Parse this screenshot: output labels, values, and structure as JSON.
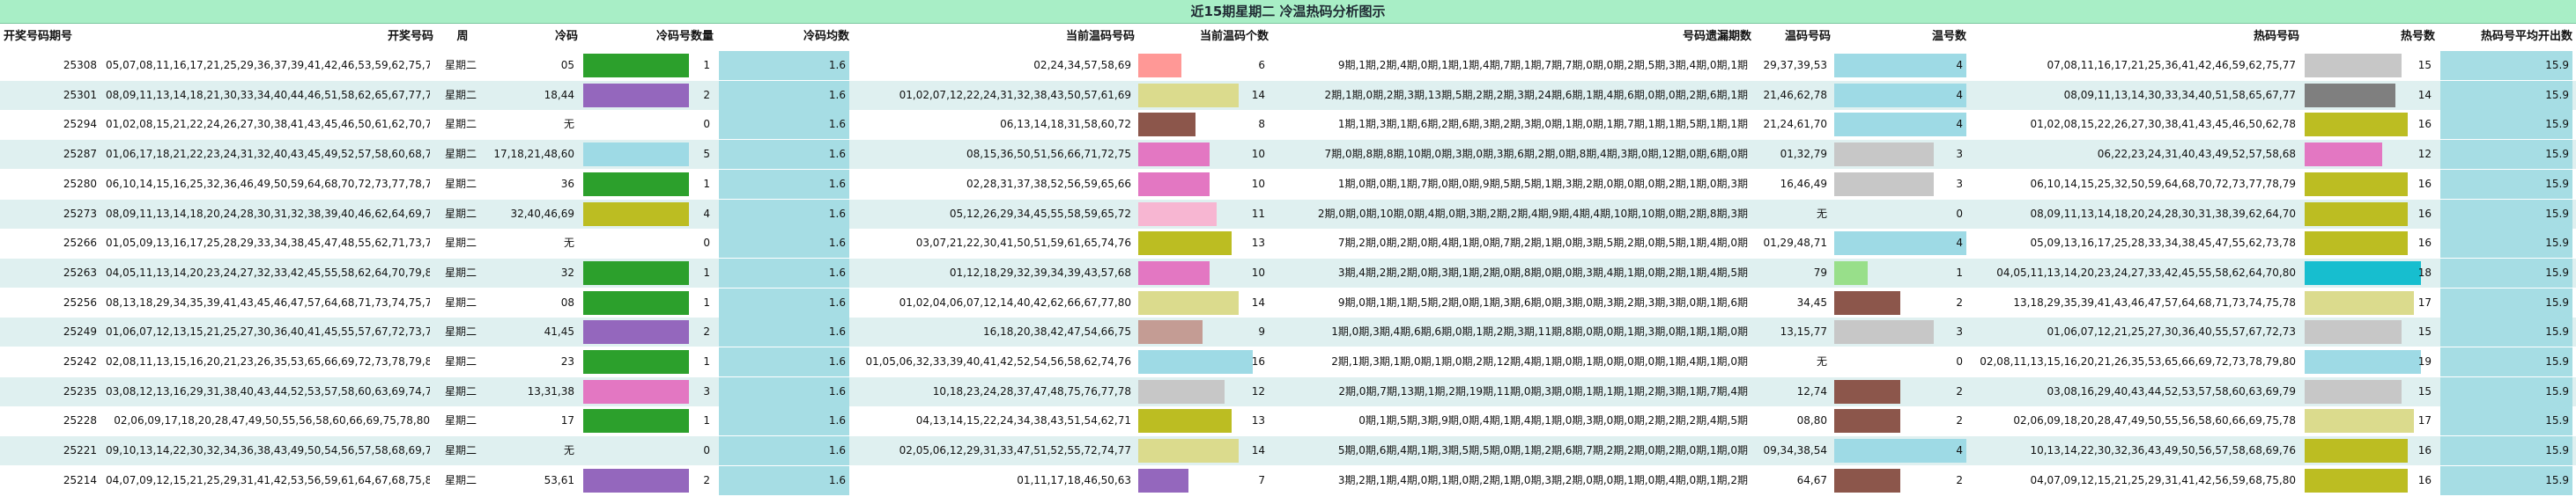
{
  "title": "近15期星期二 冷温热码分析图示",
  "headers": [
    "开奖号码期号",
    "开奖号码",
    "周",
    "冷码",
    "冷码号数量",
    "冷码均数",
    "当前温码号码",
    "当前温码个数",
    "号码遗漏期数",
    "温码号码",
    "温号数",
    "热码号码",
    "热号数",
    "热码号平均开出数"
  ],
  "rows": [
    {
      "issue": "25308",
      "numbers": "05,07,08,11,16,17,21,25,29,36,37,39,41,42,46,53,59,62,75,77",
      "week": "星期二",
      "cold": "05",
      "cold_count": "1",
      "cold_avg": "1.6",
      "warm_cur": "02,24,34,57,58,69",
      "warm_cur_count": "6",
      "miss": "9期,1期,2期,4期,0期,1期,1期,4期,7期,1期,7期,7期,0期,0期,2期,5期,3期,4期,0期,1期",
      "warm": "29,37,39,53",
      "warm_count": "4",
      "hot": "07,08,11,16,17,21,25,36,41,42,46,59,62,75,77",
      "hot_count": "15",
      "hot_avg": "15.9",
      "cold_color": "#2ca02c",
      "cold_frac": 1,
      "warm_cur_color": "#ff9896",
      "warm_cur_frac": 0.375,
      "warm_color": "#9edae5",
      "warm_frac": 1,
      "hot_color": "#c7c7c7",
      "hot_frac": 0.83
    },
    {
      "issue": "25301",
      "numbers": "08,09,11,13,14,18,21,30,33,34,40,44,46,51,58,62,65,67,77,78",
      "week": "星期二",
      "cold": "18,44",
      "cold_count": "2",
      "cold_avg": "1.6",
      "warm_cur": "01,02,07,12,22,24,31,32,38,43,50,57,61,69",
      "warm_cur_count": "14",
      "miss": "2期,1期,0期,2期,3期,13期,5期,2期,2期,3期,24期,6期,1期,4期,6期,0期,0期,2期,6期,1期",
      "warm": "21,46,62,78",
      "warm_count": "4",
      "hot": "08,09,11,13,14,30,33,34,40,51,58,65,67,77",
      "hot_count": "14",
      "hot_avg": "15.9",
      "cold_color": "#9467bd",
      "cold_frac": 1,
      "warm_cur_color": "#dbdb8d",
      "warm_cur_frac": 0.875,
      "warm_color": "#9edae5",
      "warm_frac": 1,
      "hot_color": "#7f7f7f",
      "hot_frac": 0.78
    },
    {
      "issue": "25294",
      "numbers": "01,02,08,15,21,22,24,26,27,30,38,41,43,45,46,50,61,62,70,78",
      "week": "星期二",
      "cold": "无",
      "cold_count": "0",
      "cold_avg": "1.6",
      "warm_cur": "06,13,14,18,31,58,60,72",
      "warm_cur_count": "8",
      "miss": "1期,1期,3期,1期,6期,2期,6期,3期,2期,3期,0期,1期,0期,1期,7期,1期,1期,5期,1期,1期",
      "warm": "21,24,61,70",
      "warm_count": "4",
      "hot": "01,02,08,15,22,26,27,30,38,41,43,45,46,50,62,78",
      "hot_count": "16",
      "hot_avg": "15.9",
      "cold_color": "#ffffff",
      "cold_frac": 0,
      "warm_cur_color": "#8c564b",
      "warm_cur_frac": 0.5,
      "warm_color": "#9edae5",
      "warm_frac": 1,
      "hot_color": "#bcbd22",
      "hot_frac": 0.89
    },
    {
      "issue": "25287",
      "numbers": "01,06,17,18,21,22,23,24,31,32,40,43,45,49,52,57,58,60,68,79",
      "week": "星期二",
      "cold": "17,18,21,48,60",
      "cold_count": "5",
      "cold_avg": "1.6",
      "warm_cur": "08,15,36,50,51,56,66,71,72,75",
      "warm_cur_count": "10",
      "miss": "7期,0期,8期,8期,10期,0期,3期,0期,3期,6期,2期,0期,8期,4期,3期,0期,12期,0期,6期,0期",
      "warm": "01,32,79",
      "warm_count": "3",
      "hot": "06,22,23,24,31,40,43,49,52,57,58,68",
      "hot_count": "12",
      "hot_avg": "15.9",
      "cold_color": "#9edae5",
      "cold_frac": 1,
      "warm_cur_color": "#e377c2",
      "warm_cur_frac": 0.625,
      "warm_color": "#c7c7c7",
      "warm_frac": 0.75,
      "hot_color": "#e377c2",
      "hot_frac": 0.67
    },
    {
      "issue": "25280",
      "numbers": "06,10,14,15,16,25,32,36,46,49,50,59,64,68,70,72,73,77,78,79",
      "week": "星期二",
      "cold": "36",
      "cold_count": "1",
      "cold_avg": "1.6",
      "warm_cur": "02,28,31,37,38,52,56,59,65,66",
      "warm_cur_count": "10",
      "miss": "1期,0期,0期,1期,7期,0期,0期,9期,5期,5期,1期,3期,2期,0期,0期,0期,2期,1期,0期,3期",
      "warm": "16,46,49",
      "warm_count": "3",
      "hot": "06,10,14,15,25,32,50,59,64,68,70,72,73,77,78,79",
      "hot_count": "16",
      "hot_avg": "15.9",
      "cold_color": "#2ca02c",
      "cold_frac": 1,
      "warm_cur_color": "#e377c2",
      "warm_cur_frac": 0.625,
      "warm_color": "#c7c7c7",
      "warm_frac": 0.75,
      "hot_color": "#bcbd22",
      "hot_frac": 0.89
    },
    {
      "issue": "25273",
      "numbers": "08,09,11,13,14,18,20,24,28,30,31,32,38,39,40,46,62,64,69,70",
      "week": "星期二",
      "cold": "32,40,46,69",
      "cold_count": "4",
      "cold_avg": "1.6",
      "warm_cur": "05,12,26,29,34,45,55,58,59,65,72",
      "warm_cur_count": "11",
      "miss": "2期,0期,0期,10期,0期,4期,0期,3期,2期,2期,4期,9期,4期,4期,10期,10期,0期,2期,8期,3期",
      "warm": "无",
      "warm_count": "0",
      "hot": "08,09,11,13,14,18,20,24,28,30,31,38,39,62,64,70",
      "hot_count": "16",
      "hot_avg": "15.9",
      "cold_color": "#bcbd22",
      "cold_frac": 1,
      "warm_cur_color": "#f7b6d2",
      "warm_cur_frac": 0.6875,
      "warm_color": "#ffffff",
      "warm_frac": 0,
      "hot_color": "#bcbd22",
      "hot_frac": 0.89
    },
    {
      "issue": "25266",
      "numbers": "01,05,09,13,16,17,25,28,29,33,34,38,45,47,48,55,62,71,73,78",
      "week": "星期二",
      "cold": "无",
      "cold_count": "0",
      "cold_avg": "1.6",
      "warm_cur": "03,07,21,22,30,41,50,51,59,61,65,74,76",
      "warm_cur_count": "13",
      "miss": "7期,2期,0期,2期,0期,4期,1期,0期,7期,2期,1期,0期,3期,5期,2期,0期,5期,1期,4期,0期",
      "warm": "01,29,48,71",
      "warm_count": "4",
      "hot": "05,09,13,16,17,25,28,33,34,38,45,47,55,62,73,78",
      "hot_count": "16",
      "hot_avg": "15.9",
      "cold_color": "#ffffff",
      "cold_frac": 0,
      "warm_cur_color": "#bcbd22",
      "warm_cur_frac": 0.8125,
      "warm_color": "#9edae5",
      "warm_frac": 1,
      "hot_color": "#bcbd22",
      "hot_frac": 0.89
    },
    {
      "issue": "25263",
      "numbers": "04,05,11,13,14,20,23,24,27,32,33,42,45,55,58,62,64,70,79,80",
      "week": "星期二",
      "cold": "32",
      "cold_count": "1",
      "cold_avg": "1.6",
      "warm_cur": "01,12,18,29,32,39,34,39,43,57,68",
      "warm_cur_count": "10",
      "miss": "3期,4期,2期,2期,0期,3期,1期,2期,0期,8期,0期,0期,3期,4期,1期,0期,2期,1期,4期,5期",
      "warm": "79",
      "warm_count": "1",
      "hot": "04,05,11,13,14,20,23,24,27,33,42,45,55,58,62,64,70,80",
      "hot_count": "18",
      "hot_avg": "15.9",
      "cold_color": "#2ca02c",
      "cold_frac": 1,
      "warm_cur_color": "#e377c2",
      "warm_cur_frac": 0.625,
      "warm_color": "#98df8a",
      "warm_frac": 0.25,
      "hot_color": "#17becf",
      "hot_frac": 1
    },
    {
      "issue": "25256",
      "numbers": "08,13,18,29,34,35,39,41,43,45,46,47,57,64,68,71,73,74,75,78",
      "week": "星期二",
      "cold": "08",
      "cold_count": "1",
      "cold_avg": "1.6",
      "warm_cur": "01,02,04,06,07,12,14,40,42,62,66,67,77,80",
      "warm_cur_count": "14",
      "miss": "9期,0期,1期,1期,5期,2期,0期,1期,3期,6期,0期,3期,0期,3期,2期,3期,3期,0期,1期,6期",
      "warm": "34,45",
      "warm_count": "2",
      "hot": "13,18,29,35,39,41,43,46,47,57,64,68,71,73,74,75,78",
      "hot_count": "17",
      "hot_avg": "15.9",
      "cold_color": "#2ca02c",
      "cold_frac": 1,
      "warm_cur_color": "#dbdb8d",
      "warm_cur_frac": 0.875,
      "warm_color": "#8c564b",
      "warm_frac": 0.5,
      "hot_color": "#dbdb8d",
      "hot_frac": 0.94
    },
    {
      "issue": "25249",
      "numbers": "01,06,07,12,13,15,21,25,27,30,36,40,41,45,55,57,67,72,73,77",
      "week": "星期二",
      "cold": "41,45",
      "cold_count": "2",
      "cold_avg": "1.6",
      "warm_cur": "16,18,20,38,42,47,54,66,75",
      "warm_cur_count": "9",
      "miss": "1期,0期,3期,4期,6期,6期,0期,1期,2期,3期,11期,8期,0期,0期,1期,3期,0期,1期,1期,0期",
      "warm": "13,15,77",
      "warm_count": "3",
      "hot": "01,06,07,12,21,25,27,30,36,40,55,57,67,72,73",
      "hot_count": "15",
      "hot_avg": "15.9",
      "cold_color": "#9467bd",
      "cold_frac": 1,
      "warm_cur_color": "#c49c94",
      "warm_cur_frac": 0.5625,
      "warm_color": "#c7c7c7",
      "warm_frac": 0.75,
      "hot_color": "#c7c7c7",
      "hot_frac": 0.83
    },
    {
      "issue": "25242",
      "numbers": "02,08,11,13,15,16,20,21,23,26,35,53,65,66,69,72,73,78,79,80",
      "week": "星期二",
      "cold": "23",
      "cold_count": "1",
      "cold_avg": "1.6",
      "warm_cur": "01,05,06,32,33,39,40,41,42,52,54,56,58,62,74,76",
      "warm_cur_count": "16",
      "miss": "2期,1期,3期,1期,0期,1期,0期,2期,12期,4期,1期,0期,1期,0期,0期,0期,1期,4期,1期,0期",
      "warm": "无",
      "warm_count": "0",
      "hot": "02,08,11,13,15,16,20,21,26,35,53,65,66,69,72,73,78,79,80",
      "hot_count": "19",
      "hot_avg": "15.9",
      "cold_color": "#2ca02c",
      "cold_frac": 1,
      "warm_cur_color": "#9edae5",
      "warm_cur_frac": 1,
      "warm_color": "#ffffff",
      "warm_frac": 0,
      "hot_color": "#9edae5",
      "hot_frac": 1
    },
    {
      "issue": "25235",
      "numbers": "03,08,12,13,16,29,31,38,40,43,44,52,53,57,58,60,63,69,74,79",
      "week": "星期二",
      "cold": "13,31,38",
      "cold_count": "3",
      "cold_avg": "1.6",
      "warm_cur": "10,18,23,24,28,37,47,48,75,76,77,78",
      "warm_cur_count": "12",
      "miss": "2期,0期,7期,13期,1期,2期,19期,11期,0期,3期,0期,1期,1期,1期,2期,3期,1期,7期,4期",
      "warm": "12,74",
      "warm_count": "2",
      "hot": "03,08,16,29,40,43,44,52,53,57,58,60,63,69,79",
      "hot_count": "15",
      "hot_avg": "15.9",
      "cold_color": "#e377c2",
      "cold_frac": 1,
      "warm_cur_color": "#c7c7c7",
      "warm_cur_frac": 0.75,
      "warm_color": "#8c564b",
      "warm_frac": 0.5,
      "hot_color": "#c7c7c7",
      "hot_frac": 0.83
    },
    {
      "issue": "25228",
      "numbers": "02,06,09,17,18,20,28,47,49,50,55,56,58,60,66,69,75,78,80",
      "week": "星期二",
      "cold": "17",
      "cold_count": "1",
      "cold_avg": "1.6",
      "warm_cur": "04,13,14,15,22,24,34,38,43,51,54,62,71",
      "warm_cur_count": "13",
      "miss": "0期,1期,5期,3期,9期,0期,4期,1期,4期,1期,0期,3期,0期,0期,2期,2期,2期,4期,5期",
      "warm": "08,80",
      "warm_count": "2",
      "hot": "02,06,09,18,20,28,47,49,50,55,56,58,60,66,69,75,78",
      "hot_count": "17",
      "hot_avg": "15.9",
      "cold_color": "#2ca02c",
      "cold_frac": 1,
      "warm_cur_color": "#bcbd22",
      "warm_cur_frac": 0.8125,
      "warm_color": "#8c564b",
      "warm_frac": 0.5,
      "hot_color": "#dbdb8d",
      "hot_frac": 0.94
    },
    {
      "issue": "25221",
      "numbers": "09,10,13,14,22,30,32,34,36,38,43,49,50,54,56,57,58,68,69,76",
      "week": "星期二",
      "cold": "无",
      "cold_count": "0",
      "cold_avg": "1.6",
      "warm_cur": "02,05,06,12,29,31,33,47,51,52,55,72,74,77",
      "warm_cur_count": "14",
      "miss": "5期,0期,6期,4期,1期,3期,5期,5期,0期,1期,2期,6期,7期,2期,2期,0期,2期,0期,1期,0期",
      "warm": "09,34,38,54",
      "warm_count": "4",
      "hot": "10,13,14,22,30,32,36,43,49,50,56,57,58,68,69,76",
      "hot_count": "16",
      "hot_avg": "15.9",
      "cold_color": "#ffffff",
      "cold_frac": 0,
      "warm_cur_color": "#dbdb8d",
      "warm_cur_frac": 0.875,
      "warm_color": "#9edae5",
      "warm_frac": 1,
      "hot_color": "#bcbd22",
      "hot_frac": 0.89
    },
    {
      "issue": "25214",
      "numbers": "04,07,09,12,15,21,25,29,31,41,42,53,56,59,61,64,67,68,75,80",
      "week": "星期二",
      "cold": "53,61",
      "cold_count": "2",
      "cold_avg": "1.6",
      "warm_cur": "01,11,17,18,46,50,63",
      "warm_cur_count": "7",
      "miss": "3期,2期,1期,4期,0期,1期,0期,2期,1期,0期,3期,2期,0期,0期,1期,0期,4期,0期,1期,2期",
      "warm": "64,67",
      "warm_count": "2",
      "hot": "04,07,09,12,15,21,25,29,31,41,42,56,59,68,75,80",
      "hot_count": "16",
      "hot_avg": "15.9",
      "cold_color": "#9467bd",
      "cold_frac": 1,
      "warm_cur_color": "#9467bd",
      "warm_cur_frac": 0.4375,
      "warm_color": "#8c564b",
      "warm_frac": 0.5,
      "hot_color": "#bcbd22",
      "hot_frac": 0.89
    }
  ]
}
